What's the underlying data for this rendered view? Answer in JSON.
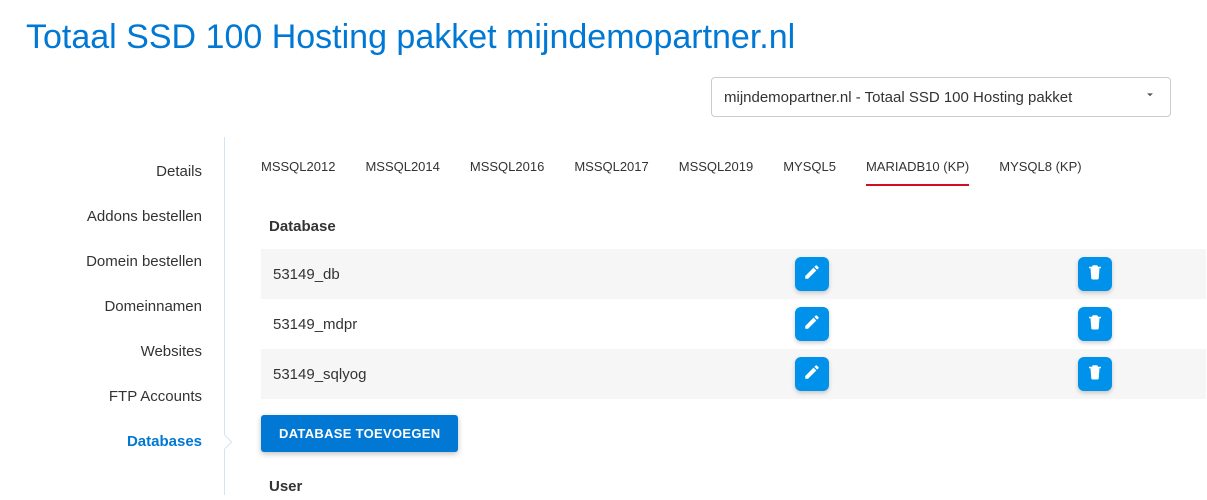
{
  "page_title": "Totaal SSD 100 Hosting pakket mijndemopartner.nl",
  "package_selector": {
    "selected": "mijndemopartner.nl - Totaal SSD 100 Hosting pakket"
  },
  "sidebar": {
    "items": [
      {
        "label": "Details",
        "active": false
      },
      {
        "label": "Addons bestellen",
        "active": false
      },
      {
        "label": "Domein bestellen",
        "active": false
      },
      {
        "label": "Domeinnamen",
        "active": false
      },
      {
        "label": "Websites",
        "active": false
      },
      {
        "label": "FTP Accounts",
        "active": false
      },
      {
        "label": "Databases",
        "active": true
      }
    ]
  },
  "tabs": [
    {
      "label": "MSSQL2012",
      "active": false
    },
    {
      "label": "MSSQL2014",
      "active": false
    },
    {
      "label": "MSSQL2016",
      "active": false
    },
    {
      "label": "MSSQL2017",
      "active": false
    },
    {
      "label": "MSSQL2019",
      "active": false
    },
    {
      "label": "MYSQL5",
      "active": false
    },
    {
      "label": "MARIADB10 (KP)",
      "active": true
    },
    {
      "label": "MYSQL8 (KP)",
      "active": false
    }
  ],
  "section_database_heading": "Database",
  "databases": [
    {
      "name": "53149_db"
    },
    {
      "name": "53149_mdpr"
    },
    {
      "name": "53149_sqlyog"
    }
  ],
  "add_database_button": "DATABASE TOEVOEGEN",
  "section_user_heading": "User"
}
